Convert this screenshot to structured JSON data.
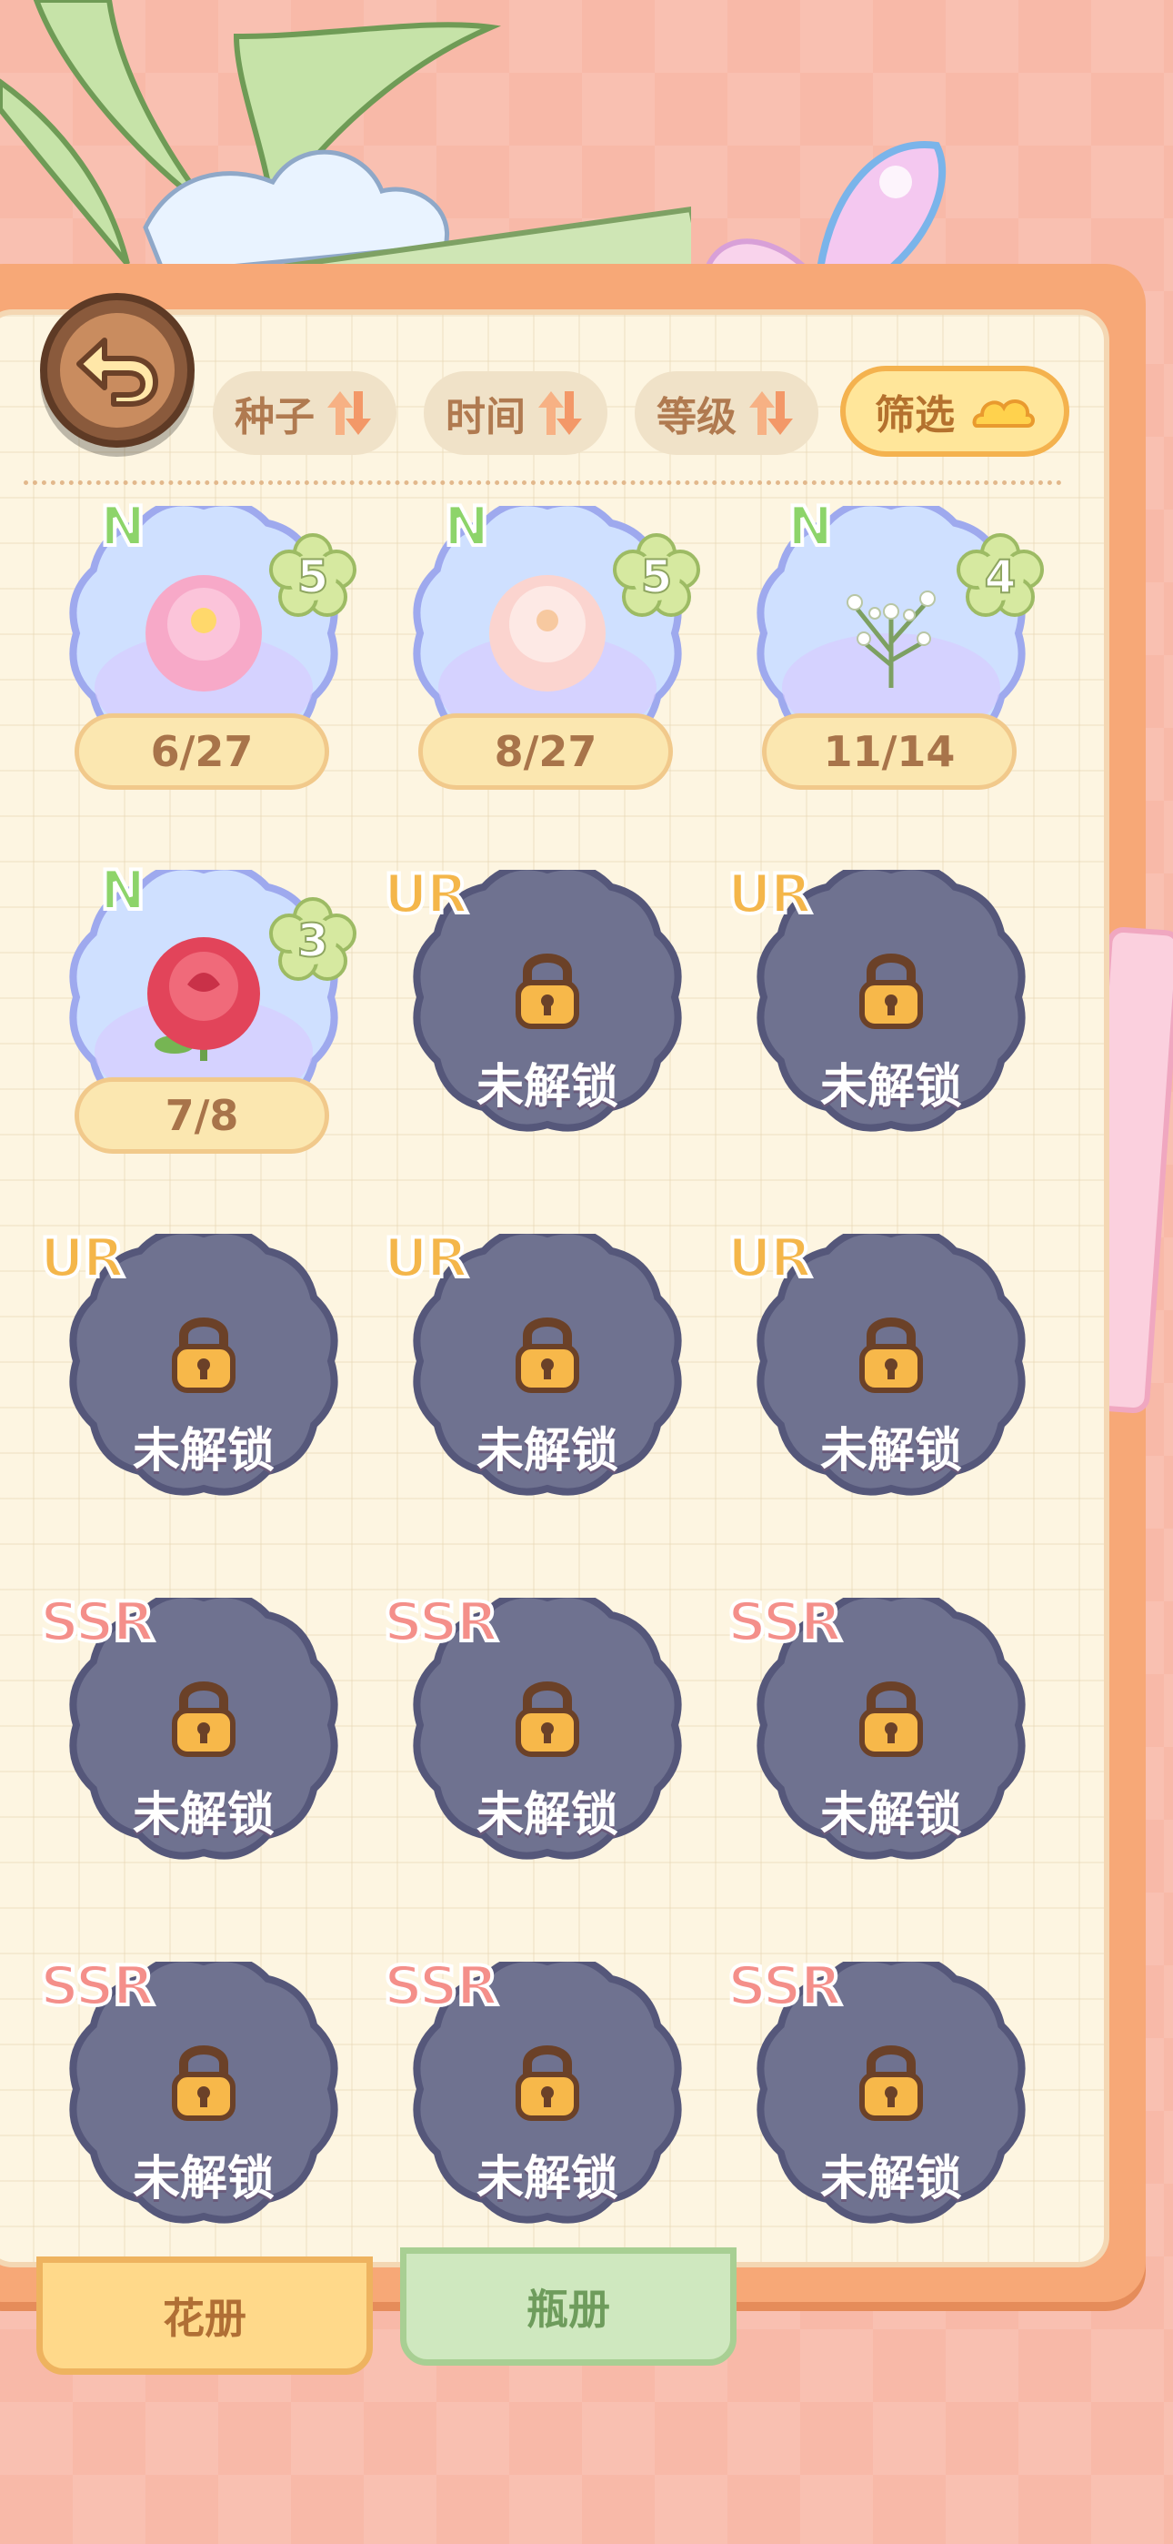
{
  "header": {
    "sort_buttons": [
      {
        "label": "种子"
      },
      {
        "label": "时间"
      },
      {
        "label": "等级"
      }
    ],
    "filter_label": "筛选"
  },
  "cards": [
    {
      "rarity": "N",
      "level": "5",
      "count": "6/27",
      "locked": false,
      "flower": "pink-peony"
    },
    {
      "rarity": "N",
      "level": "5",
      "count": "8/27",
      "locked": false,
      "flower": "white-peony"
    },
    {
      "rarity": "N",
      "level": "4",
      "count": "11/14",
      "locked": false,
      "flower": "baby-breath"
    },
    {
      "rarity": "N",
      "level": "3",
      "count": "7/8",
      "locked": false,
      "flower": "red-rose"
    },
    {
      "rarity": "UR",
      "locked": true,
      "locked_label": "未解锁"
    },
    {
      "rarity": "UR",
      "locked": true,
      "locked_label": "未解锁"
    },
    {
      "rarity": "UR",
      "locked": true,
      "locked_label": "未解锁"
    },
    {
      "rarity": "UR",
      "locked": true,
      "locked_label": "未解锁"
    },
    {
      "rarity": "UR",
      "locked": true,
      "locked_label": "未解锁"
    },
    {
      "rarity": "SSR",
      "locked": true,
      "locked_label": "未解锁"
    },
    {
      "rarity": "SSR",
      "locked": true,
      "locked_label": "未解锁"
    },
    {
      "rarity": "SSR",
      "locked": true,
      "locked_label": "未解锁"
    },
    {
      "rarity": "SSR",
      "locked": true,
      "locked_label": "未解锁"
    },
    {
      "rarity": "SSR",
      "locked": true,
      "locked_label": "未解锁"
    },
    {
      "rarity": "SSR",
      "locked": true,
      "locked_label": "未解锁"
    }
  ],
  "tabs": [
    {
      "label": "花册",
      "active": true
    },
    {
      "label": "瓶册",
      "active": false
    }
  ],
  "colors": {
    "background": "#f8b9a8",
    "frame": "#f7a877",
    "paper": "#fdf5e1",
    "locked_card": "#6f7290",
    "unlocked_card": "#cfe0ff"
  }
}
